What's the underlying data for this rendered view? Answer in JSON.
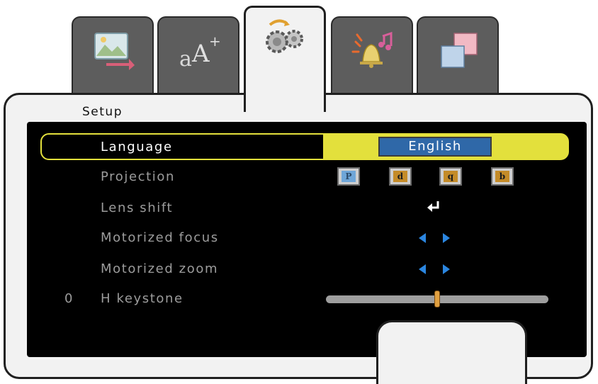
{
  "tabs": [
    {
      "name": "picture",
      "icon": "picture-icon",
      "active": false
    },
    {
      "name": "text",
      "icon": "text-size-icon",
      "active": false
    },
    {
      "name": "setup",
      "icon": "gears-icon",
      "active": true
    },
    {
      "name": "alerts",
      "icon": "bell-icon",
      "active": false
    },
    {
      "name": "options",
      "icon": "windows-icon",
      "active": false
    }
  ],
  "panel": {
    "title": "Setup"
  },
  "menu": {
    "language": {
      "label": "Language",
      "value": "English"
    },
    "projection": {
      "label": "Projection",
      "options": [
        "P",
        "d",
        "q",
        "b"
      ],
      "selected_index": 0
    },
    "lens_shift": {
      "label": "Lens shift",
      "icon": "enter-icon"
    },
    "motorized_focus": {
      "label": "Motorized focus",
      "icon": "left-right-arrows-icon"
    },
    "motorized_zoom": {
      "label": "Motorized zoom",
      "icon": "left-right-arrows-icon"
    },
    "h_keystone": {
      "label": "H keystone",
      "value": "0",
      "slider_fraction": 0.5
    }
  },
  "colors": {
    "highlight": "#e3e03c",
    "value_box": "#2f68a8",
    "arrow": "#2b86e0",
    "slider_thumb": "#e0a040"
  }
}
